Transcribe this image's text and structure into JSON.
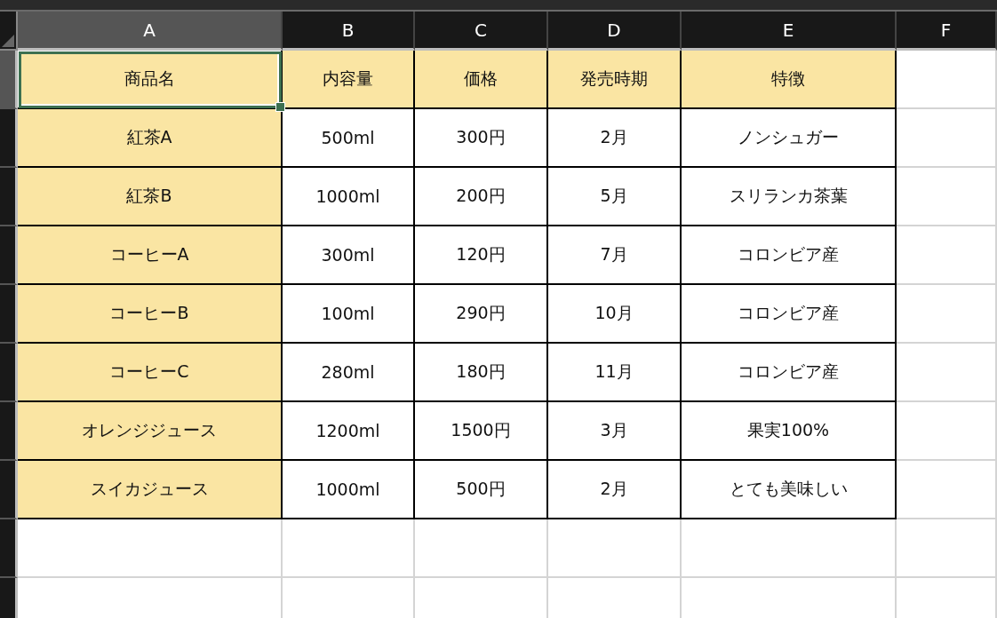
{
  "columns": [
    {
      "label": "A",
      "selected": true
    },
    {
      "label": "B",
      "selected": false
    },
    {
      "label": "C",
      "selected": false
    },
    {
      "label": "D",
      "selected": false
    },
    {
      "label": "E",
      "selected": false
    },
    {
      "label": "F",
      "selected": false
    }
  ],
  "rows": [
    {
      "kind": "header",
      "cells": [
        {
          "text": "商品名",
          "selected": true
        },
        {
          "text": "内容量",
          "selected": false
        },
        {
          "text": "価格",
          "selected": false
        },
        {
          "text": "発売時期",
          "selected": false
        },
        {
          "text": "特徴",
          "selected": false
        }
      ]
    },
    {
      "kind": "data",
      "cells": [
        {
          "text": "紅茶A",
          "selected": false
        },
        {
          "text": "500ml",
          "selected": false
        },
        {
          "text": "300円",
          "selected": false
        },
        {
          "text": "2月",
          "selected": false
        },
        {
          "text": "ノンシュガー",
          "selected": false
        }
      ]
    },
    {
      "kind": "data",
      "cells": [
        {
          "text": "紅茶B",
          "selected": false
        },
        {
          "text": "1000ml",
          "selected": false
        },
        {
          "text": "200円",
          "selected": false
        },
        {
          "text": "5月",
          "selected": false
        },
        {
          "text": "スリランカ茶葉",
          "selected": false
        }
      ]
    },
    {
      "kind": "data",
      "cells": [
        {
          "text": "コーヒーA",
          "selected": false
        },
        {
          "text": "300ml",
          "selected": false
        },
        {
          "text": "120円",
          "selected": false
        },
        {
          "text": "7月",
          "selected": false
        },
        {
          "text": "コロンビア産",
          "selected": false
        }
      ]
    },
    {
      "kind": "data",
      "cells": [
        {
          "text": "コーヒーB",
          "selected": false
        },
        {
          "text": "100ml",
          "selected": false
        },
        {
          "text": "290円",
          "selected": false
        },
        {
          "text": "10月",
          "selected": false
        },
        {
          "text": "コロンビア産",
          "selected": false
        }
      ]
    },
    {
      "kind": "data",
      "cells": [
        {
          "text": "コーヒーC",
          "selected": false
        },
        {
          "text": "280ml",
          "selected": false
        },
        {
          "text": "180円",
          "selected": false
        },
        {
          "text": "11月",
          "selected": false
        },
        {
          "text": "コロンビア産",
          "selected": false
        }
      ]
    },
    {
      "kind": "data",
      "cells": [
        {
          "text": "オレンジジュース",
          "selected": false
        },
        {
          "text": "1200ml",
          "selected": false
        },
        {
          "text": "1500円",
          "selected": false
        },
        {
          "text": "3月",
          "selected": false
        },
        {
          "text": "果実100%",
          "selected": false
        }
      ]
    },
    {
      "kind": "data",
      "cells": [
        {
          "text": "スイカジュース",
          "selected": false
        },
        {
          "text": "1000ml",
          "selected": false
        },
        {
          "text": "500円",
          "selected": false
        },
        {
          "text": "2月",
          "selected": false
        },
        {
          "text": "とても美味しい",
          "selected": false
        }
      ]
    }
  ]
}
